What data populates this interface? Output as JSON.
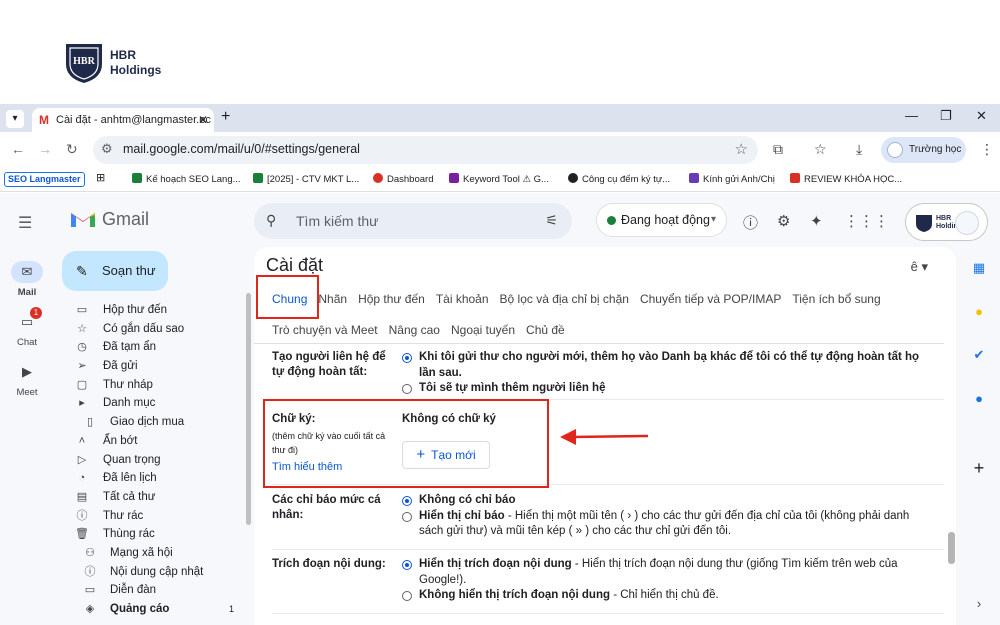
{
  "logo": {
    "line1": "HBR",
    "line2": "Holdings"
  },
  "browser": {
    "tab_title": "Cài đặt - anhtm@langmaster.ec",
    "url": "mail.google.com/mail/u/0/#settings/general",
    "profile_label": "Trường học",
    "bookmarks": [
      {
        "label": "SEO Langmaster"
      },
      {
        "label": "Kế hoạch SEO Lang...",
        "color": "#188038"
      },
      {
        "label": "[2025] - CTV MKT L...",
        "color": "#188038"
      },
      {
        "label": "Dashboard",
        "color": "#d93025"
      },
      {
        "label": "Keyword Tool ⚠ G...",
        "color": "#7b1fa2"
      },
      {
        "label": "Công cụ đếm ký tự...",
        "color": "#202124"
      },
      {
        "label": "Kính gửi Anh/Chị",
        "color": "#673ab7"
      },
      {
        "label": "REVIEW KHÓA HỌC...",
        "color": "#d93025"
      }
    ]
  },
  "gmail": {
    "brand": "Gmail",
    "search_placeholder": "Tìm kiếm thư",
    "status": "Đang hoạt động",
    "compose": "Soạn thư",
    "rail": [
      {
        "label": "Mail"
      },
      {
        "label": "Chat",
        "badge": "1"
      },
      {
        "label": "Meet"
      }
    ],
    "account_label": [
      "HBR",
      "Holdings"
    ],
    "nav": [
      {
        "label": "Hộp thư đến",
        "icon": "inbox-icon",
        "glyph": "▭"
      },
      {
        "label": "Có gắn dấu sao",
        "icon": "star-icon",
        "glyph": "☆"
      },
      {
        "label": "Đã tạm ẩn",
        "icon": "clock-icon",
        "glyph": "◷"
      },
      {
        "label": "Đã gửi",
        "icon": "send-icon",
        "glyph": "➢"
      },
      {
        "label": "Thư nháp",
        "icon": "draft-icon",
        "glyph": "▢"
      },
      {
        "label": "Danh mục",
        "icon": "label-icon",
        "glyph": "▸"
      },
      {
        "label": "Giao dịch mua",
        "icon": "shopping-icon",
        "glyph": "▯",
        "sub": true
      },
      {
        "label": "Ẩn bớt",
        "icon": "chevron-up-icon",
        "glyph": "˄"
      },
      {
        "label": "Quan trọng",
        "icon": "important-icon",
        "glyph": "▷"
      },
      {
        "label": "Đã lên lịch",
        "icon": "scheduled-icon",
        "glyph": "◔"
      },
      {
        "label": "Tất cả thư",
        "icon": "all-mail-icon",
        "glyph": "▤"
      },
      {
        "label": "Thư rác",
        "icon": "spam-icon",
        "glyph": "ⓘ"
      },
      {
        "label": "Thùng rác",
        "icon": "trash-icon",
        "glyph": "🗑"
      },
      {
        "label": "Mạng xã hội",
        "icon": "social-icon",
        "glyph": "⚇",
        "sub": true
      },
      {
        "label": "Nội dung cập nhật",
        "icon": "updates-icon",
        "glyph": "ⓘ",
        "sub": true
      },
      {
        "label": "Diễn đàn",
        "icon": "forums-icon",
        "glyph": "▭",
        "sub": true
      },
      {
        "label": "Quảng cáo",
        "icon": "promotions-icon",
        "glyph": "◈",
        "sub": true,
        "count": "1"
      }
    ]
  },
  "settings": {
    "title": "Cài đặt",
    "lang": "ê ▾",
    "tabs_row1": [
      "Chung",
      "Nhãn",
      "Hộp thư đến",
      "Tài khoản",
      "Bộ lọc và địa chỉ bị chặn",
      "Chuyển tiếp và POP/IMAP",
      "Tiện ích bổ sung"
    ],
    "tabs_row2": [
      "Trò chuyện và Meet",
      "Nâng cao",
      "Ngoại tuyến",
      "Chủ đề"
    ],
    "contacts": {
      "label": "Tạo người liên hệ để tự động hoàn tất:",
      "opt1": "Khi tôi gửi thư cho người mới, thêm họ vào Danh bạ khác để tôi có thể tự động hoàn tất họ lần sau.",
      "opt2": "Tôi sẽ tự mình thêm người liên hệ"
    },
    "signature": {
      "label": "Chữ ký:",
      "hint": "(thêm chữ ký vào cuối tất cả thư đi)",
      "link": "Tìm hiểu thêm",
      "none": "Không có chữ ký",
      "create": "Tạo mới"
    },
    "indicators": {
      "label": "Các chỉ báo mức cá nhân:",
      "opt1": "Không có chỉ báo",
      "opt2_bold": "Hiển thị chỉ báo",
      "opt2_rest": " - Hiển thị một mũi tên ( › ) cho các thư gửi đến địa chỉ của tôi (không phải danh sách gửi thư) và mũi tên kép ( » ) cho các thư chỉ gửi đến tôi."
    },
    "snippets": {
      "label": "Trích đoạn nội dung:",
      "opt1_bold": "Hiển thị trích đoạn nội dung",
      "opt1_rest": " - Hiển thị trích đoạn nội dung thư (giống Tìm kiếm trên web của Google!).",
      "opt2_bold": "Không hiển thị trích đoạn nội dung",
      "opt2_rest": " - Chỉ hiển thị chủ đề."
    }
  },
  "colors": {
    "annotation": "#e0251b",
    "accent": "#0b57d0"
  }
}
